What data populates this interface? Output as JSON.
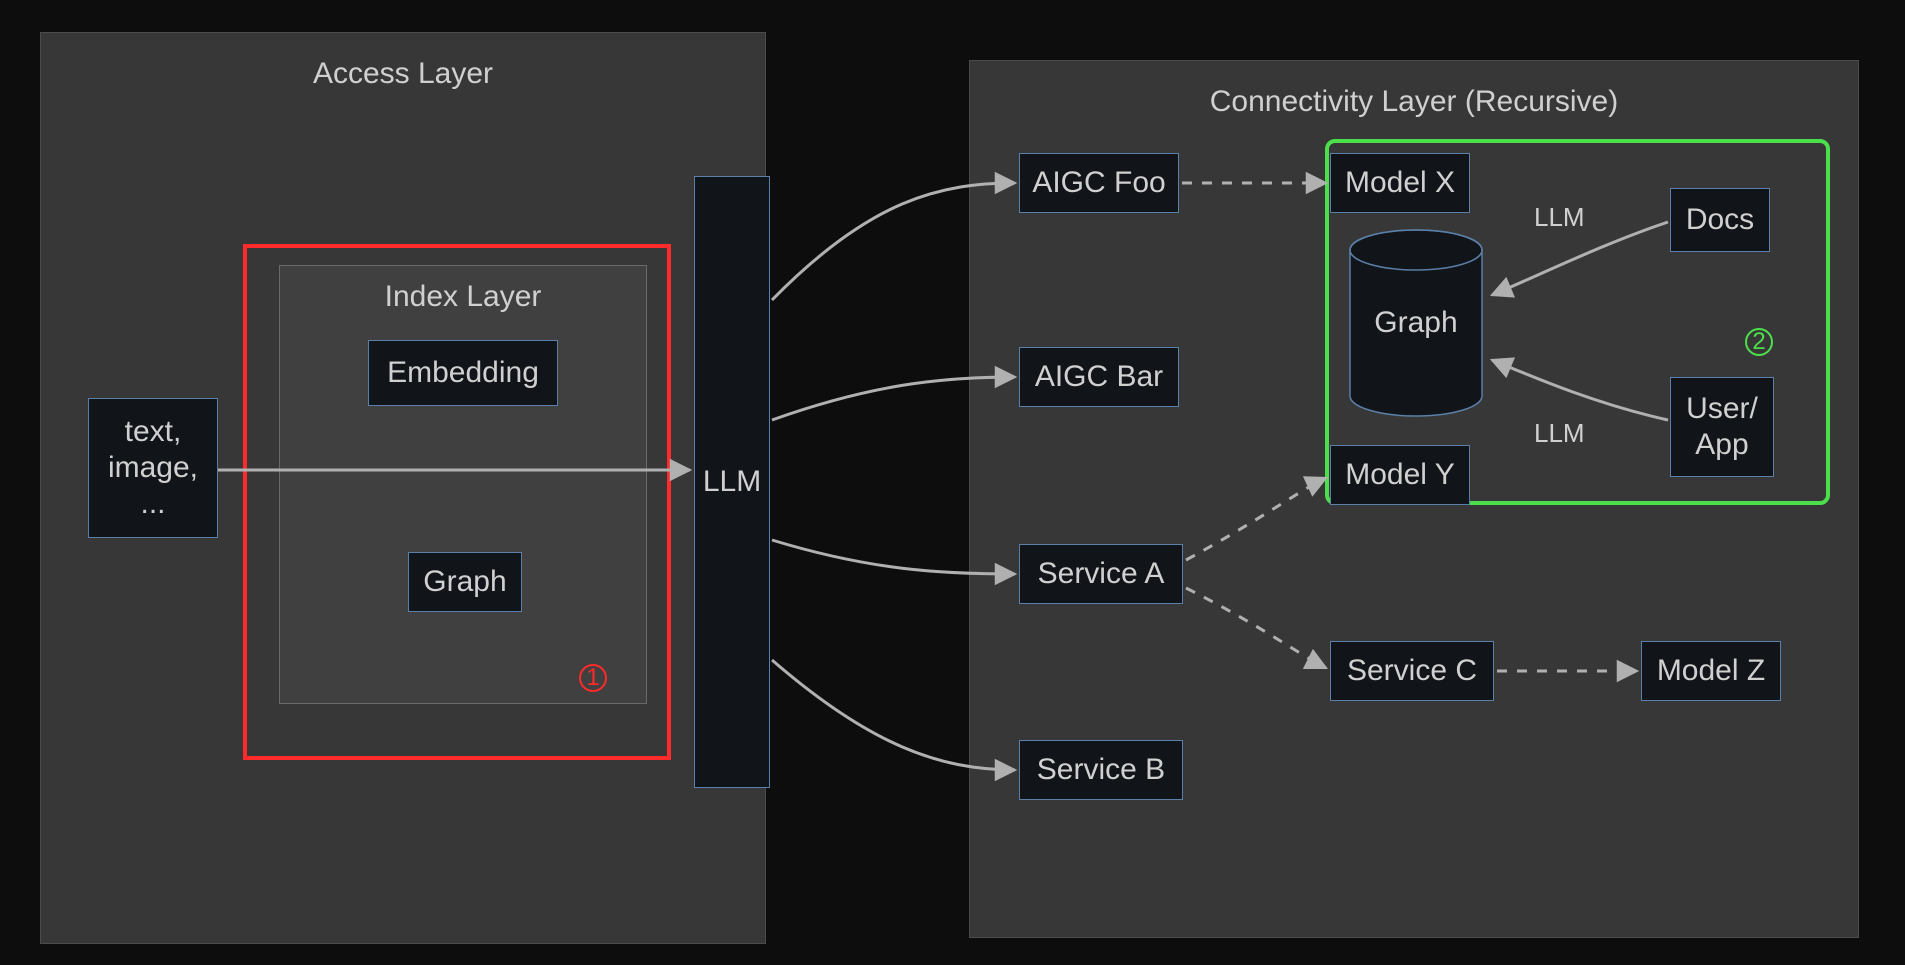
{
  "access_layer": {
    "title": "Access Layer",
    "input_node": "text,\nimage,\n...",
    "index_layer": {
      "title": "Index Layer",
      "embedding": "Embedding",
      "graph": "Graph"
    },
    "llm": "LLM",
    "highlight_badge": "1"
  },
  "connectivity_layer": {
    "title": "Connectivity Layer (Recursive)",
    "aigc_foo": "AIGC Foo",
    "aigc_bar": "AIGC Bar",
    "service_a": "Service A",
    "service_b": "Service B",
    "service_c": "Service C",
    "model_x": "Model X",
    "model_y": "Model Y",
    "model_z": "Model Z",
    "graph_db": "Graph",
    "docs": "Docs",
    "user_app": "User/\nApp",
    "edge_llm_1": "LLM",
    "edge_llm_2": "LLM",
    "highlight_badge": "2"
  },
  "colors": {
    "bg": "#0d0d0d",
    "panel": "#373737",
    "subpanel": "#404040",
    "node_bg": "#111418",
    "node_border": "#5a7fa8",
    "arrow": "#b0b0b0",
    "red": "#ff2a2a",
    "green": "#4be04b"
  }
}
